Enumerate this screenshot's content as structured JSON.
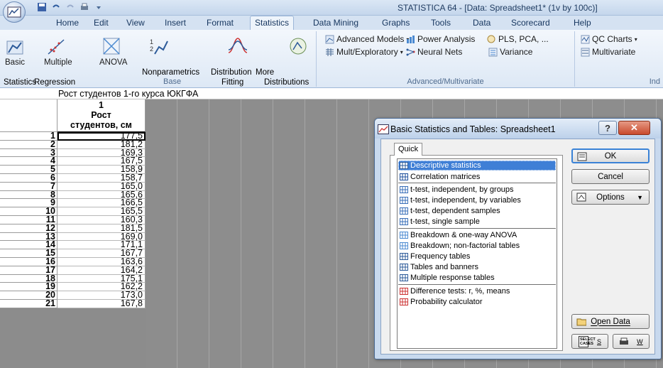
{
  "window": {
    "title": "STATISTICA 64 - [Data: Spreadsheet1* (1v by 100c)]"
  },
  "ribbon_tabs": [
    "Home",
    "Edit",
    "View",
    "Insert",
    "Format",
    "Statistics",
    "Data Mining",
    "Graphs",
    "Tools",
    "Data",
    "Scorecard",
    "Help"
  ],
  "active_tab": "Statistics",
  "ribbon": {
    "base": {
      "basic_statistics_line1": "Basic",
      "basic_statistics_line2": "Statistics",
      "multiple_regression_line1": "Multiple",
      "multiple_regression_line2": "Regression",
      "anova": "ANOVA",
      "nonparametrics": "Nonparametrics",
      "distribution_fitting_line1": "Distribution",
      "distribution_fitting_line2": "Fitting",
      "more_distributions_line1": "More",
      "more_distributions_line2": "Distributions",
      "group_label": "Base"
    },
    "advanced": {
      "advanced_models": "Advanced Models",
      "power_analysis": "Power Analysis",
      "pls_pca": "PLS, PCA, ...",
      "mult_exploratory": "Mult/Exploratory",
      "neural_nets": "Neural Nets",
      "variance": "Variance",
      "group_label": "Advanced/Multivariate"
    },
    "industrial": {
      "qc_charts": "QC Charts",
      "multivariate": "Multivariate",
      "group_label": "Ind"
    }
  },
  "spreadsheet": {
    "title": "Рост студентов 1-го курса ЮКГФА",
    "column": {
      "number": "1",
      "name_line1": "Рост",
      "name_line2": "студентов, см"
    },
    "rows": [
      {
        "n": "1",
        "value": "177,5"
      },
      {
        "n": "2",
        "value": "181,2"
      },
      {
        "n": "3",
        "value": "169,3"
      },
      {
        "n": "4",
        "value": "167,5"
      },
      {
        "n": "5",
        "value": "158,9"
      },
      {
        "n": "6",
        "value": "158,7"
      },
      {
        "n": "7",
        "value": "165,0"
      },
      {
        "n": "8",
        "value": "165,6"
      },
      {
        "n": "9",
        "value": "166,5"
      },
      {
        "n": "10",
        "value": "165,5"
      },
      {
        "n": "11",
        "value": "160,3"
      },
      {
        "n": "12",
        "value": "181,5"
      },
      {
        "n": "13",
        "value": "169,0"
      },
      {
        "n": "14",
        "value": "171,1"
      },
      {
        "n": "15",
        "value": "167,7"
      },
      {
        "n": "16",
        "value": "163,6"
      },
      {
        "n": "17",
        "value": "164,2"
      },
      {
        "n": "18",
        "value": "175,1"
      },
      {
        "n": "19",
        "value": "162,2"
      },
      {
        "n": "20",
        "value": "173,0"
      },
      {
        "n": "21",
        "value": "167,8"
      }
    ]
  },
  "dialog": {
    "title": "Basic Statistics and Tables: Spreadsheet1",
    "tab": "Quick",
    "items": [
      "Descriptive statistics",
      "Correlation matrices",
      "t-test, independent, by groups",
      "t-test, independent, by variables",
      "t-test, dependent samples",
      "t-test, single sample",
      "Breakdown & one-way ANOVA",
      "Breakdown; non-factorial tables",
      "Frequency tables",
      "Tables and banners",
      "Multiple response tables",
      "Difference tests: r, %, means",
      "Probability calculator"
    ],
    "selected_item": "Descriptive statistics",
    "buttons": {
      "ok": "OK",
      "cancel": "Cancel",
      "options": "Options",
      "open_data": "Open Data",
      "select_cases_icon_text": "SELECT CASES",
      "s": "S",
      "w": "W"
    }
  },
  "colors": {
    "ribbon_bg": "#dde8f5",
    "selection": "#3f7fd6",
    "sheet_gray": "#8d8d8d",
    "close_button": "#c94a2d"
  }
}
